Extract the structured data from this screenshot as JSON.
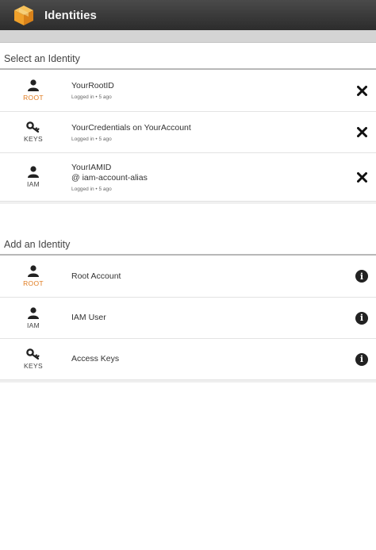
{
  "app": {
    "title": "Identities",
    "icon": "aws-cube-icon",
    "accent": "#f0a12b"
  },
  "colors": {
    "root_label": "#e07b1f",
    "actionbar": "#3a3a3a"
  },
  "select_section": {
    "header": "Select an Identity",
    "items": [
      {
        "badge": "ROOT",
        "badge_icon": "user-icon",
        "line1": "YourRootID",
        "line2": "",
        "status": "Logged in • 5 ago",
        "action_icon": "close-icon"
      },
      {
        "badge": "KEYS",
        "badge_icon": "key-icon",
        "line1": "YourCredentials on YourAccount",
        "line2": "",
        "status": "Logged in • 5 ago",
        "action_icon": "close-icon"
      },
      {
        "badge": "IAM",
        "badge_icon": "user-icon",
        "line1": "YourIAMID",
        "line2": "@ iam-account-alias",
        "status": "Logged in • 5 ago",
        "action_icon": "close-icon"
      }
    ]
  },
  "add_section": {
    "header": "Add an Identity",
    "items": [
      {
        "badge": "ROOT",
        "badge_icon": "user-icon",
        "label": "Root Account",
        "action_icon": "info-icon",
        "info_glyph": "i"
      },
      {
        "badge": "IAM",
        "badge_icon": "user-icon",
        "label": "IAM User",
        "action_icon": "info-icon",
        "info_glyph": "i"
      },
      {
        "badge": "KEYS",
        "badge_icon": "key-icon",
        "label": "Access Keys",
        "action_icon": "info-icon",
        "info_glyph": "i"
      }
    ]
  }
}
